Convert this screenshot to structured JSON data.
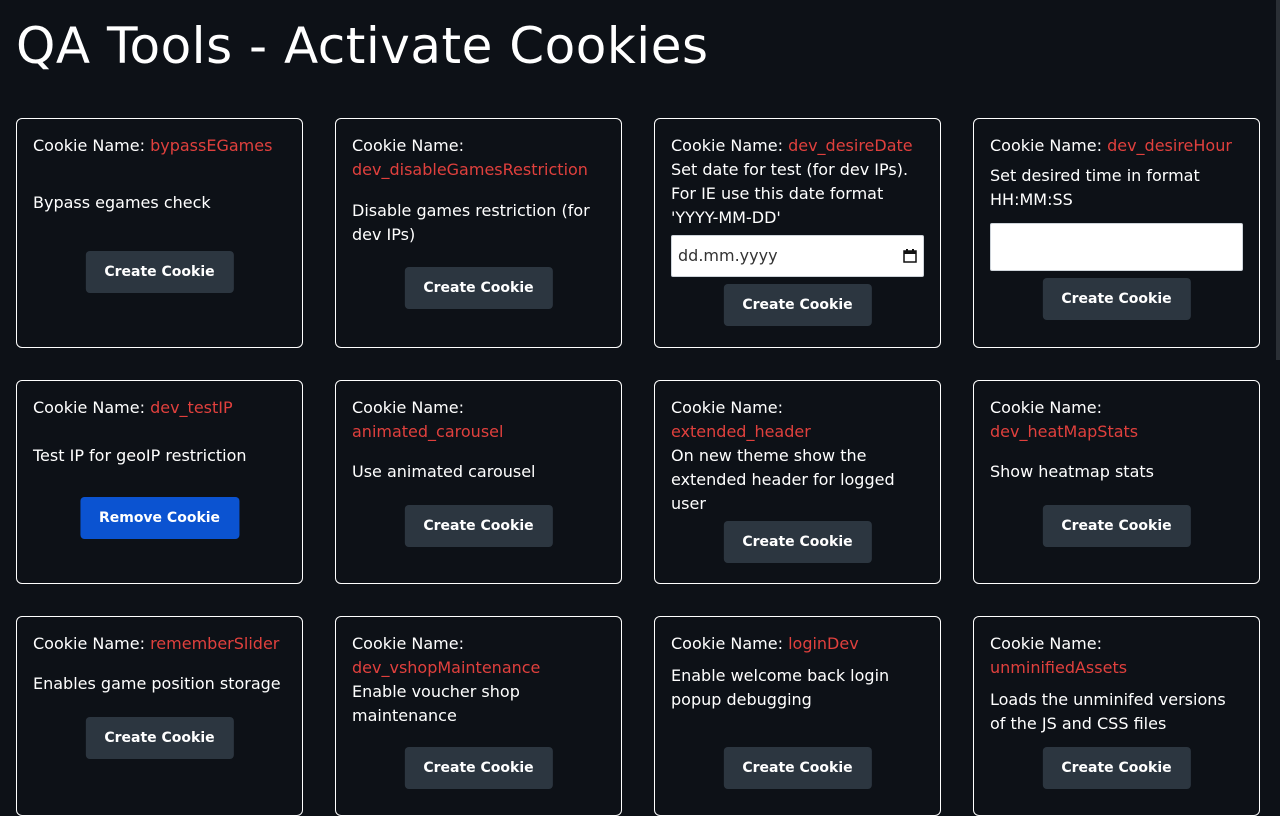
{
  "page": {
    "title": "QA Tools - Activate Cookies"
  },
  "cookie_label": "Cookie Name:",
  "cards": [
    {
      "name": "bypassEGames",
      "desc": "Bypass egames check",
      "button": "Create Cookie"
    },
    {
      "name": "dev_disableGamesRestriction",
      "desc": "Disable games restriction (for dev IPs)",
      "button": "Create Cookie"
    },
    {
      "name": "dev_desireDate",
      "desc": "Set date for test (for dev IPs). For IE use this date format 'YYYY-MM-DD'",
      "input_value": "dd.mm.yyyy",
      "button": "Create Cookie"
    },
    {
      "name": "dev_desireHour",
      "desc": "Set desired time in format HH:MM:SS",
      "input_value": "",
      "button": "Create Cookie"
    },
    {
      "name": "dev_testIP",
      "desc": "Test IP for geoIP restriction",
      "button": "Remove Cookie"
    },
    {
      "name": "animated_carousel",
      "desc": "Use animated carousel",
      "button": "Create Cookie"
    },
    {
      "name": "extended_header",
      "desc": "On new theme show the extended header for logged user",
      "button": "Create Cookie"
    },
    {
      "name": "dev_heatMapStats",
      "desc": "Show heatmap stats",
      "button": "Create Cookie"
    },
    {
      "name": "rememberSlider",
      "desc": "Enables game position storage",
      "button": "Create Cookie"
    },
    {
      "name": "dev_vshopMaintenance",
      "desc": "Enable voucher shop maintenance",
      "button": "Create Cookie"
    },
    {
      "name": "loginDev",
      "desc": "Enable welcome back login popup debugging",
      "button": "Create Cookie"
    },
    {
      "name": "unminifiedAssets",
      "desc": "Loads the unminifed versions of the JS and CSS files",
      "button": "Create Cookie"
    }
  ],
  "colors": {
    "background": "#0d1117",
    "accent_name": "#e0403d",
    "button_dark": "#2c3640",
    "button_blue": "#0b53d1"
  }
}
